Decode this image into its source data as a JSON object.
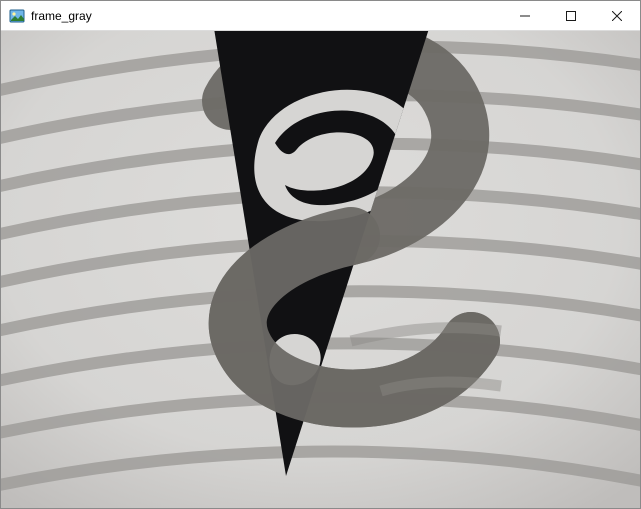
{
  "window": {
    "title": "frame_gray",
    "icon_name": "app-image-icon",
    "controls": {
      "minimize": "Minimize",
      "maximize": "Maximize",
      "close": "Close"
    }
  },
  "image": {
    "description": "Grayscale frame showing a dark triangular shape with an S-curve over faint diagonal stripes",
    "colors": {
      "bg_light": "#d8d7d5",
      "bg_vignette": "#bfbdbb",
      "stripe": "#9c9a97",
      "stripe_dark": "#8b8986",
      "curve_gray": "#6b6965",
      "curve_gray_dark": "#5e5c58",
      "figure_black": "#111113"
    }
  }
}
